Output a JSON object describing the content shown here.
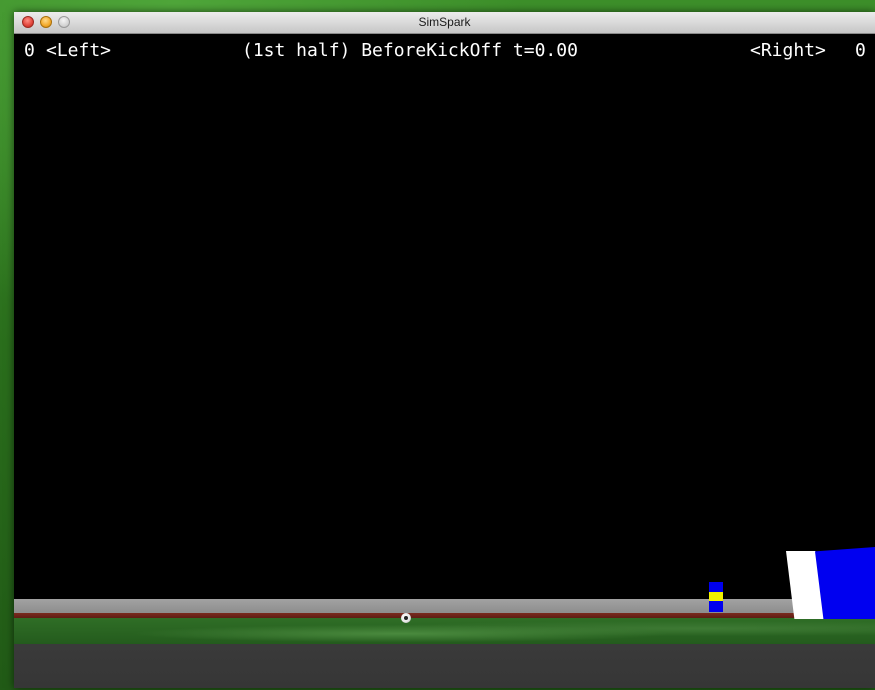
{
  "window": {
    "title": "SimSpark",
    "buttons": {
      "close": "close-button",
      "minimize": "minimize-button",
      "zoom": "zoom-button"
    }
  },
  "hud": {
    "score_left": "0",
    "team_left": "<Left>",
    "game_state": "(1st half) BeforeKickOff t=0.00",
    "team_right": "<Right>",
    "score_right": "0"
  },
  "scene": {
    "background_color": "#000000",
    "pitch_color": "#2f6e26",
    "wall_color": "#9a9a9a",
    "ground_color": "#3a3a3a",
    "player_colors": [
      "#0000ee",
      "#f2f200"
    ],
    "goal_colors": [
      "#ffffff",
      "#0000f0"
    ]
  }
}
